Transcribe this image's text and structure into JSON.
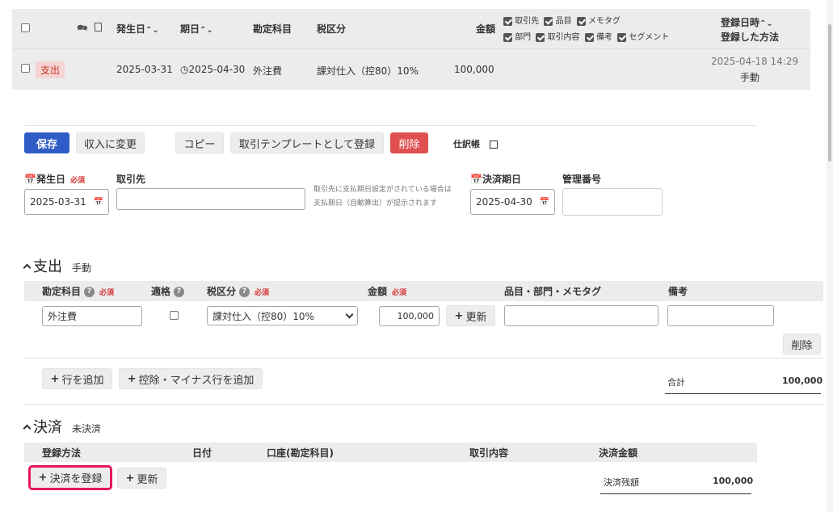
{
  "summary": {
    "headers": {
      "issue_date": "発生日",
      "due_date": "期日",
      "account": "勘定科目",
      "tax": "税区分",
      "amount": "金額",
      "registered_at": "登録日時",
      "registered_method": "登録した方法"
    },
    "column_toggles": [
      {
        "label": "取引先",
        "checked": true
      },
      {
        "label": "品目",
        "checked": true
      },
      {
        "label": "メモタグ",
        "checked": true
      },
      {
        "label": "部門",
        "checked": true
      },
      {
        "label": "取引内容",
        "checked": true
      },
      {
        "label": "備考",
        "checked": true
      },
      {
        "label": "セグメント",
        "checked": true
      }
    ],
    "row": {
      "type_badge": "支出",
      "issue_date": "2025-03-31",
      "due_date": "2025-04-30",
      "account": "外注費",
      "tax": "課対仕入（控80）10%",
      "amount": "100,000",
      "registered_at": "2025-04-18 14:29",
      "registered_method": "手動"
    }
  },
  "toolbar": {
    "save": "保存",
    "change_to_income": "収入に変更",
    "copy": "コピー",
    "register_template": "取引テンプレートとして登録",
    "delete": "削除",
    "journal": "仕訳帳"
  },
  "form": {
    "issue_date_label": "発生日",
    "issue_date_value": "2025-03-31",
    "required": "必須",
    "partner_label": "取引先",
    "partner_value": "",
    "partner_hint_1": "取引先に支払期日設定がされている場合は",
    "partner_hint_2": "支払期日（自動算出）が提示されます",
    "settle_date_label": "決済期日",
    "settle_date_value": "2025-04-30",
    "mgmt_no_label": "管理番号",
    "mgmt_no_value": ""
  },
  "expense": {
    "title": "支出",
    "sub": "手動",
    "headers": {
      "account": "勘定科目",
      "qualified": "適格",
      "tax": "税区分",
      "amount": "金額",
      "items": "品目・部門・メモタグ",
      "note": "備考"
    },
    "row": {
      "account": "外注費",
      "tax": "課対仕入（控80）10%",
      "amount": "100,000",
      "update": "更新"
    },
    "row_delete": "削除",
    "add_row": "行を追加",
    "add_deduction_row": "控除・マイナス行を追加",
    "total_label": "合計",
    "total_value": "100,000"
  },
  "settlement": {
    "title": "決済",
    "sub": "未決済",
    "headers": {
      "method": "登録方法",
      "date": "日付",
      "account": "口座(勘定科目)",
      "content": "取引内容",
      "amount": "決済金額"
    },
    "register": "決済を登録",
    "update": "更新",
    "balance_label": "決済残額",
    "balance_value": "100,000"
  },
  "colors": {
    "blue": "#2f5cc7",
    "red": "#e05050",
    "highlight": "#e6175c",
    "badge_bg": "#f7d4d4"
  }
}
